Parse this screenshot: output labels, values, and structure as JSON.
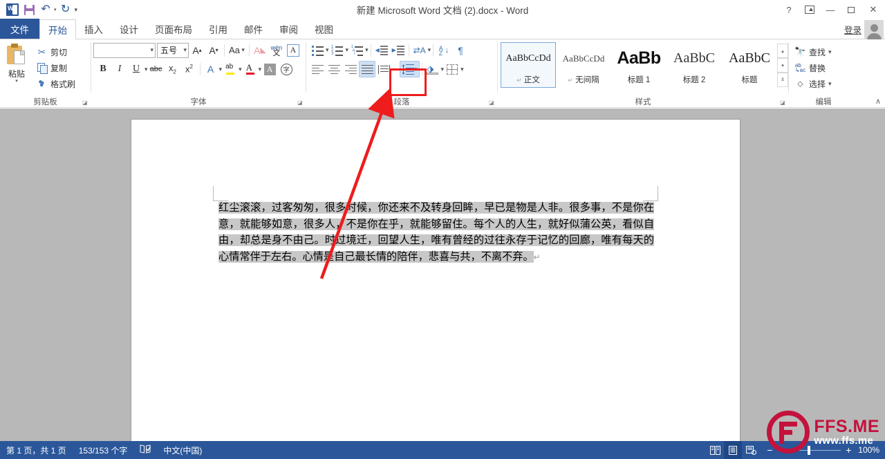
{
  "window": {
    "title": "新建 Microsoft Word 文档 (2).docx - Word",
    "help_label": "?",
    "ribbon_display_label": "ribbon-display-options",
    "minimize_label": "—",
    "restore_label": "restore",
    "close_label": "✕",
    "signin_label": "登录"
  },
  "quick_access": {
    "word_letter": "W",
    "save_name": "save-icon",
    "undo_label": "↶",
    "redo_label": "↻",
    "customize_label": "▾"
  },
  "tabs": [
    {
      "label": "文件",
      "name": "tab-file"
    },
    {
      "label": "开始",
      "name": "tab-home",
      "active": true
    },
    {
      "label": "插入",
      "name": "tab-insert"
    },
    {
      "label": "设计",
      "name": "tab-design"
    },
    {
      "label": "页面布局",
      "name": "tab-page-layout"
    },
    {
      "label": "引用",
      "name": "tab-references"
    },
    {
      "label": "邮件",
      "name": "tab-mailings"
    },
    {
      "label": "审阅",
      "name": "tab-review"
    },
    {
      "label": "视图",
      "name": "tab-view"
    }
  ],
  "ribbon": {
    "collapse_label": "∧",
    "clipboard": {
      "group_label": "剪贴板",
      "paste_label": "粘贴",
      "paste_caret": "▾",
      "cut_label": "剪切",
      "copy_label": "复制",
      "format_painter_label": "格式刷"
    },
    "font": {
      "group_label": "字体",
      "font_name_value": "",
      "font_name_placeholder": "",
      "font_size_value": "五号",
      "grow_font_label": "A",
      "shrink_font_label": "A",
      "change_case_label": "Aa",
      "clear_format_label": "A",
      "phonetic_label": "文",
      "char_border_label": "A",
      "bold_label": "B",
      "italic_label": "I",
      "underline_label": "U",
      "strikethrough_label": "abc",
      "subscript_label": "x",
      "superscript_label": "x",
      "text_effects_label": "A",
      "highlight_label": "ab",
      "font_color_label": "A",
      "char_shading_label": "A",
      "circle_char_label": "字"
    },
    "paragraph": {
      "group_label": "段落",
      "bullets_name": "bullets-button",
      "numbering_name": "numbering-button",
      "multilevel_name": "multilevel-list-button",
      "decrease_indent_name": "decrease-indent-button",
      "increase_indent_name": "increase-indent-button",
      "cn_layout_name": "asian-layout-button",
      "sort_label": "A\nZ",
      "show_marks_label": "¶",
      "align_left_name": "align-left-button",
      "align_center_name": "align-center-button",
      "align_right_name": "align-right-button",
      "justify_name": "justify-button",
      "distribute_name": "distribute-button",
      "line_spacing_name": "line-spacing-button",
      "line_spacing_caret": "▾",
      "shading_name": "shading-button",
      "borders_name": "borders-button"
    },
    "styles": {
      "group_label": "样式",
      "items": [
        {
          "preview": "AaBbCcDd",
          "name": "正文",
          "pilcrow": "↵",
          "selected": true,
          "cls": "sp-normal"
        },
        {
          "preview": "AaBbCcDd",
          "name": "无间隔",
          "pilcrow": "↵",
          "selected": false,
          "cls": "sp-nospace"
        },
        {
          "preview": "AaBb",
          "name": "标题 1",
          "pilcrow": "",
          "selected": false,
          "cls": "sp-h1"
        },
        {
          "preview": "AaBbC",
          "name": "标题 2",
          "pilcrow": "",
          "selected": false,
          "cls": "sp-h2"
        },
        {
          "preview": "AaBbC",
          "name": "标题",
          "pilcrow": "",
          "selected": false,
          "cls": "sp-title"
        }
      ],
      "scroll_up": "▴",
      "scroll_down": "▾",
      "more": "▾"
    },
    "editing": {
      "group_label": "编辑",
      "find_label": "查找",
      "find_caret": "▾",
      "replace_label": "替换",
      "replace_icon_label": "ab\nac",
      "select_label": "选择",
      "select_caret": "▾"
    }
  },
  "document": {
    "paragraph_text": "红尘滚滚，过客匆匆，很多时候，你还来不及转身回眸，早已是物是人非。很多事，不是你在意，就能够如意，很多人，不是你在乎，就能够留住。每个人的人生，就好似蒲公英，看似自由，却总是身不由己。时过境迁，回望人生，唯有曾经的过往永存于记忆的回廊，唯有每天的心情常伴于左右。心情是自己最长情的陪伴，悲喜与共，不离不弃。",
    "paragraph_mark": "↵"
  },
  "status_bar": {
    "page_info": "第 1 页，共 1 页",
    "word_count": "153/153 个字",
    "proofing_name": "proofing-icon",
    "language": "中文(中国)",
    "view_read_name": "read-mode-button",
    "view_print_name": "print-layout-button",
    "view_web_name": "web-layout-button",
    "zoom_out_label": "−",
    "zoom_in_label": "+",
    "zoom_value": "100%"
  },
  "watermark": {
    "main": "FFS.ME",
    "sub": "www.ffs.me"
  },
  "colors": {
    "accent": "#2b579a",
    "annotation_red": "#ee1c1c",
    "watermark_red": "#c3123c",
    "selection_gray": "#c8c8c8"
  }
}
